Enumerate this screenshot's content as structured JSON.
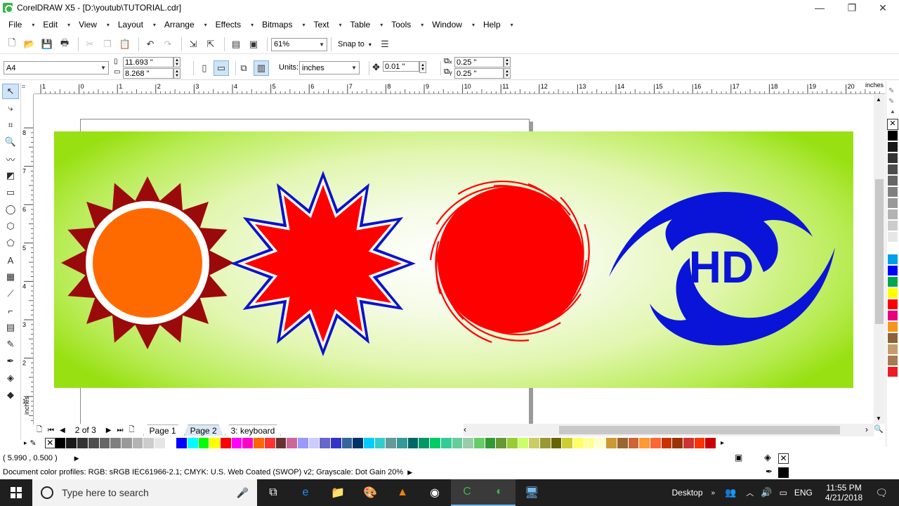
{
  "window": {
    "title": "CorelDRAW X5 - [D:\\youtub\\TUTORIAL.cdr]",
    "minimize": "—",
    "restore": "❐",
    "close": "✕"
  },
  "menus": [
    "File",
    "Edit",
    "View",
    "Layout",
    "Arrange",
    "Effects",
    "Bitmaps",
    "Text",
    "Table",
    "Tools",
    "Window",
    "Help"
  ],
  "toolbar": {
    "zoom_level": "61%",
    "snap_to": "Snap to"
  },
  "property_bar": {
    "paper_preset": "A4",
    "width": "11.693 \"",
    "height": "8.268 \"",
    "units_label": "Units:",
    "units_value": "inches",
    "nudge": "0.01 \"",
    "dup_x": "0.25 \"",
    "dup_y": "0.25 \""
  },
  "ruler": {
    "unit": "inches",
    "h_ticks": [
      "1",
      "0",
      "1",
      "2",
      "3",
      "4",
      "5",
      "6",
      "7",
      "8",
      "9",
      "10",
      "11",
      "12",
      "13",
      "14",
      "15",
      "16",
      "17",
      "18",
      "19",
      "20"
    ],
    "v_ticks": [
      "8",
      "7",
      "6",
      "5",
      "4",
      "3",
      "2",
      "1"
    ]
  },
  "artwork": {
    "logo_text": "HD",
    "colors": {
      "sun_rays": "#9b0a0a",
      "sun_core": "#ff6a00",
      "star_fill": "#ff0000",
      "star_outline": "#0a14c8",
      "swirl": "#ff0000",
      "logo_blue": "#0a14d8",
      "banner_green": "#98e012"
    }
  },
  "page_nav": {
    "position": "2 of 3",
    "tabs": [
      "Page 1",
      "Page 2",
      "3: keyboard"
    ],
    "current_tab": "Page 2"
  },
  "palette_colors": [
    "#000000",
    "#1a1a1a",
    "#333333",
    "#4d4d4d",
    "#666666",
    "#808080",
    "#999999",
    "#b3b3b3",
    "#cccccc",
    "#e6e6e6",
    "#ffffff",
    "#0000ff",
    "#00ffff",
    "#00ff00",
    "#ffff00",
    "#ff0000",
    "#ff00ff",
    "#ff00cc",
    "#ff6600",
    "#ff3333",
    "#663333",
    "#cc6699",
    "#9999ff",
    "#ccccff",
    "#6666cc",
    "#3333cc",
    "#336699",
    "#003366",
    "#00ccff",
    "#33cccc",
    "#669999",
    "#339999",
    "#006666",
    "#009966",
    "#00cc66",
    "#33cc99",
    "#66cc99",
    "#99ccaa",
    "#66cc66",
    "#339933",
    "#669933",
    "#99cc33",
    "#ccff66",
    "#cccc66",
    "#999933",
    "#666600",
    "#cccc33",
    "#ffff66",
    "#ffff99",
    "#ffffcc",
    "#cc9933",
    "#996633",
    "#cc6633",
    "#ff9933",
    "#ff6633",
    "#cc3300",
    "#993300",
    "#cc3333",
    "#ff3300",
    "#cc0000"
  ],
  "side_palette": [
    "#000000",
    "#1a1a1a",
    "#333333",
    "#4d4d4d",
    "#666666",
    "#808080",
    "#999999",
    "#b3b3b3",
    "#cccccc",
    "#e6e6e6",
    "#ffffff",
    "#00a0e9",
    "#0000ff",
    "#00a651",
    "#ffff00",
    "#ff0000",
    "#e6007e",
    "#f7941d",
    "#8c6239",
    "#c69c6d",
    "#a67c52",
    "#ed1c24"
  ],
  "status": {
    "coordinates": "( 5.990 , 0.500 )",
    "color_profiles": "Document color profiles: RGB: sRGB IEC61966-2.1; CMYK: U.S. Web Coated (SWOP) v2; Grayscale: Dot Gain 20%"
  },
  "taskbar": {
    "search_placeholder": "Type here to search",
    "desktop_label": "Desktop",
    "language": "ENG",
    "time": "11:55 PM",
    "date": "4/21/2018"
  }
}
